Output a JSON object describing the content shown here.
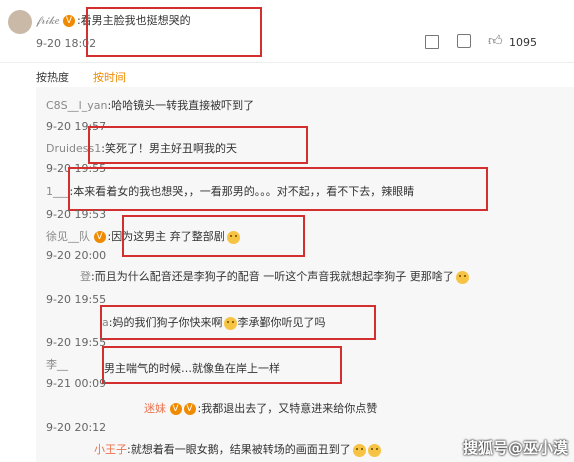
{
  "main_comment": {
    "user": "𝒻𝓇𝒾𝓀𝑒",
    "text": "看男主脸我也挺想哭的",
    "timestamp": "9-20 18:02",
    "like_count": "1095"
  },
  "sort_tabs": {
    "hot": "按热度",
    "time": "按时间"
  },
  "replies": [
    {
      "user": "C8S__l_yan",
      "text": "哈哈镜头一转我直接被吓到了",
      "timestamp": "9-20 19:57"
    },
    {
      "user": "Druidess1",
      "text": "笑死了！男主好丑啊我的天",
      "timestamp": "9-20 19:55"
    },
    {
      "user": "1___",
      "text": "本来看着女的我也想哭，，一看那男的。。。对不起，，看不下去，辣眼睛",
      "timestamp": "9-20 19:53"
    },
    {
      "user": "徐见__队",
      "text": "因为这男主 弃了整部剧",
      "timestamp": "9-20 20:00"
    },
    {
      "user": "登",
      "text": "而且为什么配音还是李狗子的配音 一听这个声音我就想起李狗子 更那啥了",
      "timestamp": "9-20 19:55"
    },
    {
      "user": "a",
      "text": "妈的我们狗子你快来啊",
      "text2": "李承鄞你听见了吗",
      "timestamp": "9-20 19:55"
    },
    {
      "user": "李__",
      "text": "男主喘气的时候…就像鱼在岸上一样",
      "timestamp": "9-21 00:09"
    },
    {
      "user": "迷妹",
      "text": "我都退出去了，又特意进来给你点赞",
      "timestamp": "9-20 20:12"
    },
    {
      "user": "小王子",
      "text": "就想着看一眼女鹅，结果被转场的画面丑到了",
      "timestamp": ""
    }
  ],
  "watermark": "搜狐号@巫小漠",
  "colors": {
    "accent": "#f08a00",
    "highlight_box": "#d32f2f",
    "reply_user": "#eb7350"
  }
}
